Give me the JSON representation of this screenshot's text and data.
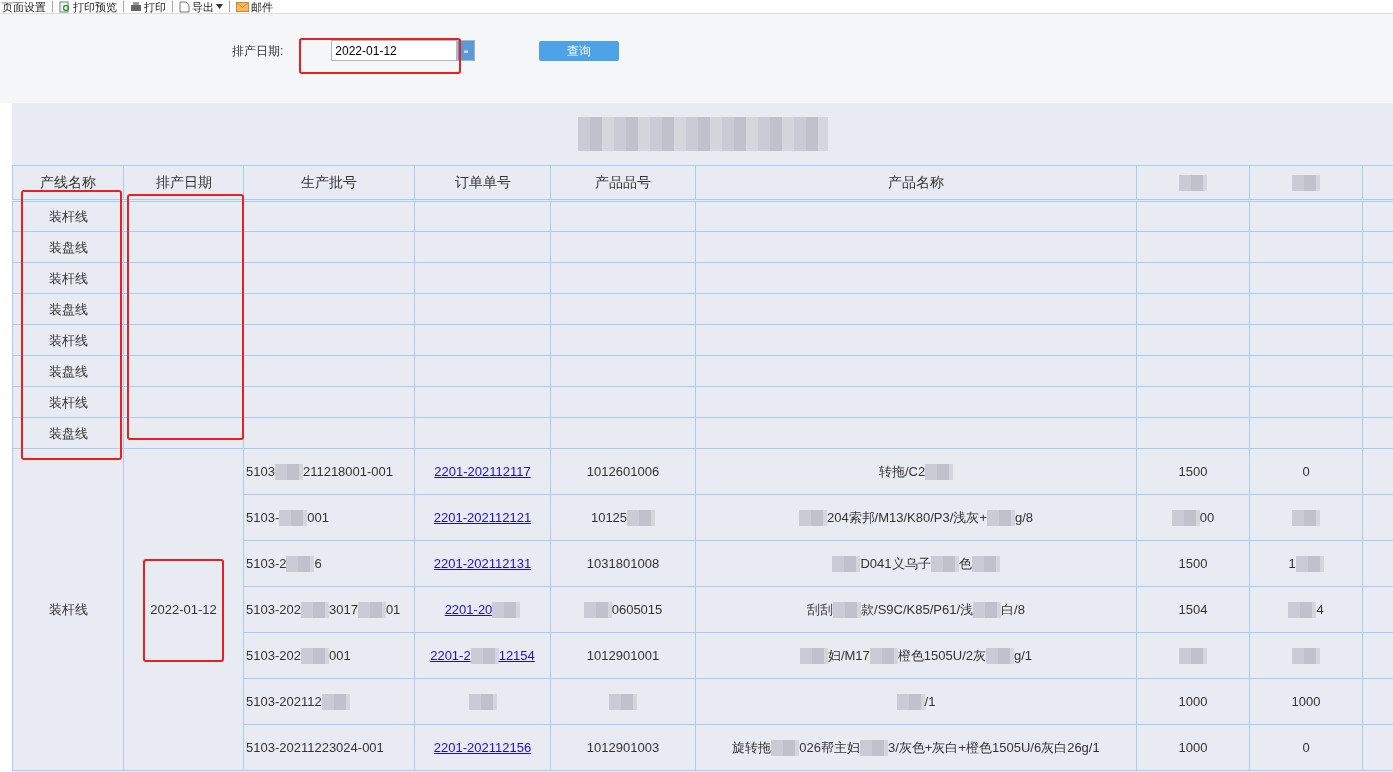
{
  "toolbar": [
    {
      "label": "页面设置"
    },
    {
      "label": "打印预览"
    },
    {
      "label": "打印"
    },
    {
      "label": "导出",
      "dropdown": true
    },
    {
      "label": "邮件"
    }
  ],
  "filter": {
    "label": "排产日期:",
    "value": "2022-01-12",
    "button": "查询"
  },
  "report": {
    "title": [
      {
        "kind": "redacted"
      }
    ],
    "columns": [
      [
        {
          "kind": "text",
          "text": "产线名称"
        }
      ],
      [
        {
          "kind": "text",
          "text": "排产日期"
        }
      ],
      [
        {
          "kind": "text",
          "text": "生产批号"
        }
      ],
      [
        {
          "kind": "text",
          "text": "订单单号"
        }
      ],
      [
        {
          "kind": "text",
          "text": "产品品号"
        }
      ],
      [
        {
          "kind": "text",
          "text": "产品名称"
        }
      ],
      [
        {
          "kind": "redacted"
        }
      ],
      [
        {
          "kind": "redacted"
        }
      ]
    ],
    "empty_rows": [
      {
        "line": "装杆线"
      },
      {
        "line": "装盘线"
      },
      {
        "line": "装杆线"
      },
      {
        "line": "装盘线"
      },
      {
        "line": "装杆线"
      },
      {
        "line": "装盘线"
      },
      {
        "line": "装杆线"
      },
      {
        "line": "装盘线"
      }
    ],
    "group": {
      "line": "装杆线",
      "date": "2022-01-12",
      "rows": [
        {
          "batch": [
            {
              "kind": "text",
              "text": "5103"
            },
            {
              "kind": "redacted"
            },
            {
              "kind": "text",
              "text": "211218001-001"
            }
          ],
          "order": [
            {
              "kind": "text",
              "text": "2201-202112117"
            }
          ],
          "code": [
            {
              "kind": "text",
              "text": "1012601006"
            }
          ],
          "name": [
            {
              "kind": "text",
              "text": "转拖/C2"
            },
            {
              "kind": "redacted"
            }
          ],
          "qty": [
            {
              "kind": "text",
              "text": "1500"
            }
          ],
          "qty2": [
            {
              "kind": "text",
              "text": "0"
            }
          ]
        },
        {
          "batch": [
            {
              "kind": "text",
              "text": "5103-"
            },
            {
              "kind": "redacted"
            },
            {
              "kind": "text",
              "text": "001"
            }
          ],
          "order": [
            {
              "kind": "text",
              "text": "2201-202112121"
            }
          ],
          "code": [
            {
              "kind": "text",
              "text": "10125"
            },
            {
              "kind": "redacted"
            }
          ],
          "name": [
            {
              "kind": "redacted"
            },
            {
              "kind": "text",
              "text": "204索邦/M13/K80/P3/浅灰+"
            },
            {
              "kind": "redacted"
            },
            {
              "kind": "text",
              "text": "g/8"
            }
          ],
          "qty": [
            {
              "kind": "redacted"
            },
            {
              "kind": "text",
              "text": "00"
            }
          ],
          "qty2": [
            {
              "kind": "redacted"
            }
          ]
        },
        {
          "batch": [
            {
              "kind": "text",
              "text": "5103-2"
            },
            {
              "kind": "redacted"
            },
            {
              "kind": "text",
              "text": "6"
            }
          ],
          "order": [
            {
              "kind": "text",
              "text": "2201-202112131"
            }
          ],
          "code": [
            {
              "kind": "text",
              "text": "1031801008"
            }
          ],
          "name": [
            {
              "kind": "redacted"
            },
            {
              "kind": "text",
              "text": "D041义乌子"
            },
            {
              "kind": "redacted"
            },
            {
              "kind": "text",
              "text": "色"
            },
            {
              "kind": "redacted"
            }
          ],
          "qty": [
            {
              "kind": "text",
              "text": "1500"
            }
          ],
          "qty2": [
            {
              "kind": "text",
              "text": "1"
            },
            {
              "kind": "redacted"
            }
          ]
        },
        {
          "batch": [
            {
              "kind": "text",
              "text": "5103-202"
            },
            {
              "kind": "redacted"
            },
            {
              "kind": "text",
              "text": "3017"
            },
            {
              "kind": "redacted"
            },
            {
              "kind": "text",
              "text": "01"
            }
          ],
          "order": [
            {
              "kind": "text",
              "text": "2201-20"
            },
            {
              "kind": "redacted"
            }
          ],
          "code": [
            {
              "kind": "redacted"
            },
            {
              "kind": "text",
              "text": "0605015"
            }
          ],
          "name": [
            {
              "kind": "text",
              "text": "刮刮"
            },
            {
              "kind": "redacted"
            },
            {
              "kind": "text",
              "text": "款/S9C/K85/P61/浅"
            },
            {
              "kind": "redacted"
            },
            {
              "kind": "text",
              "text": "白/8"
            }
          ],
          "qty": [
            {
              "kind": "text",
              "text": "1504"
            }
          ],
          "qty2": [
            {
              "kind": "redacted"
            },
            {
              "kind": "text",
              "text": "4"
            }
          ]
        },
        {
          "batch": [
            {
              "kind": "text",
              "text": "5103-202"
            },
            {
              "kind": "redacted"
            },
            {
              "kind": "text",
              "text": "001"
            }
          ],
          "order": [
            {
              "kind": "text",
              "text": "2201-2"
            },
            {
              "kind": "redacted"
            },
            {
              "kind": "text",
              "text": "12154"
            }
          ],
          "code": [
            {
              "kind": "text",
              "text": "1012901001"
            }
          ],
          "name": [
            {
              "kind": "redacted"
            },
            {
              "kind": "text",
              "text": "妇/M17"
            },
            {
              "kind": "redacted"
            },
            {
              "kind": "text",
              "text": "橙色1505U/2灰"
            },
            {
              "kind": "redacted"
            },
            {
              "kind": "text",
              "text": "g/1"
            }
          ],
          "qty": [
            {
              "kind": "redacted"
            }
          ],
          "qty2": [
            {
              "kind": "redacted"
            }
          ]
        },
        {
          "batch": [
            {
              "kind": "text",
              "text": "5103-202112"
            },
            {
              "kind": "redacted"
            }
          ],
          "order": [
            {
              "kind": "redacted"
            }
          ],
          "code": [
            {
              "kind": "redacted"
            }
          ],
          "name": [
            {
              "kind": "redacted"
            },
            {
              "kind": "text",
              "text": "/1"
            }
          ],
          "qty": [
            {
              "kind": "text",
              "text": "1000"
            }
          ],
          "qty2": [
            {
              "kind": "text",
              "text": "1000"
            }
          ]
        },
        {
          "batch": [
            {
              "kind": "text",
              "text": "5103-20211223024-001"
            }
          ],
          "order": [
            {
              "kind": "text",
              "text": "2201-202112156"
            }
          ],
          "code": [
            {
              "kind": "text",
              "text": "1012901003"
            }
          ],
          "name": [
            {
              "kind": "text",
              "text": "旋转拖"
            },
            {
              "kind": "redacted"
            },
            {
              "kind": "text",
              "text": "026帮主妇"
            },
            {
              "kind": "redacted"
            },
            {
              "kind": "text",
              "text": "3/灰色+灰白+橙色1505U/6灰白26g/1"
            }
          ],
          "qty": [
            {
              "kind": "text",
              "text": "1000"
            }
          ],
          "qty2": [
            {
              "kind": "text",
              "text": "0"
            }
          ]
        }
      ]
    }
  },
  "highlights": [
    {
      "kind": "date-field"
    },
    {
      "kind": "line-names"
    },
    {
      "kind": "empty-dates"
    },
    {
      "kind": "group-date"
    }
  ]
}
